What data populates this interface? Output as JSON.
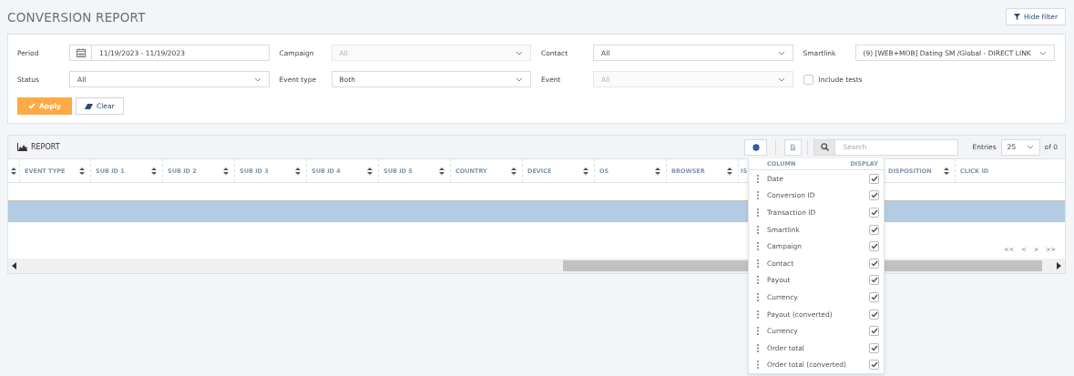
{
  "page": {
    "title": "CONVERSION REPORT",
    "hide_filter_button": "Hide filter"
  },
  "filters": [
    {
      "kind": "date",
      "label": "Period",
      "value": "11/19/2023 - 11/19/2023"
    },
    {
      "kind": "select",
      "label": "Campaign",
      "value": "All",
      "disabled": true
    },
    {
      "kind": "select",
      "label": "Contact",
      "value": "All",
      "disabled": false
    },
    {
      "kind": "select",
      "label": "Smartlink",
      "value": "(9) [WEB+MOB] Dating SM /Global - DIRECT LINK",
      "disabled": false
    },
    {
      "kind": "select",
      "label": "Status",
      "value": "All",
      "disabled": false
    },
    {
      "kind": "select",
      "label": "Event type",
      "value": "Both",
      "disabled": false
    },
    {
      "kind": "select",
      "label": "Event",
      "value": "All",
      "disabled": true
    },
    {
      "kind": "checkbox",
      "label": "Include tests",
      "checked": false
    }
  ],
  "actions": {
    "apply": "Apply",
    "clear": "Clear"
  },
  "report": {
    "title": "REPORT",
    "search_placeholder": "Search",
    "entries_label": "Entries",
    "entries_value": "25",
    "of_total": "of 0",
    "columns": [
      {
        "label": "EVENT TYPE"
      },
      {
        "label": "SUB ID 1"
      },
      {
        "label": "SUB ID 2"
      },
      {
        "label": "SUB ID 3"
      },
      {
        "label": "SUB ID 4"
      },
      {
        "label": "SUB ID 5"
      },
      {
        "label": "COUNTRY"
      },
      {
        "label": "DEVICE"
      },
      {
        "label": "OS"
      },
      {
        "label": "BROWSER"
      },
      {
        "label": "IS"
      },
      {
        "label": "DISPOSITION"
      },
      {
        "label": "CLICK ID"
      }
    ],
    "rows": [
      {
        "selected": false
      },
      {
        "selected": true
      },
      {
        "selected": false
      }
    ],
    "pagination": [
      "<<",
      "<",
      ">",
      ">>"
    ]
  },
  "column_menu": {
    "column_header": "COLUMN",
    "display_header": "DISPLAY",
    "items": [
      {
        "label": "Date",
        "checked": true
      },
      {
        "label": "Conversion ID",
        "checked": true
      },
      {
        "label": "Transaction ID",
        "checked": true
      },
      {
        "label": "Smartlink",
        "checked": true
      },
      {
        "label": "Campaign",
        "checked": true
      },
      {
        "label": "Contact",
        "checked": true
      },
      {
        "label": "Payout",
        "checked": true
      },
      {
        "label": "Currency",
        "checked": true
      },
      {
        "label": "Payout (converted)",
        "checked": true
      },
      {
        "label": "Currency",
        "checked": true
      },
      {
        "label": "Order total",
        "checked": true
      },
      {
        "label": "Order total (converted)",
        "checked": true
      }
    ]
  }
}
